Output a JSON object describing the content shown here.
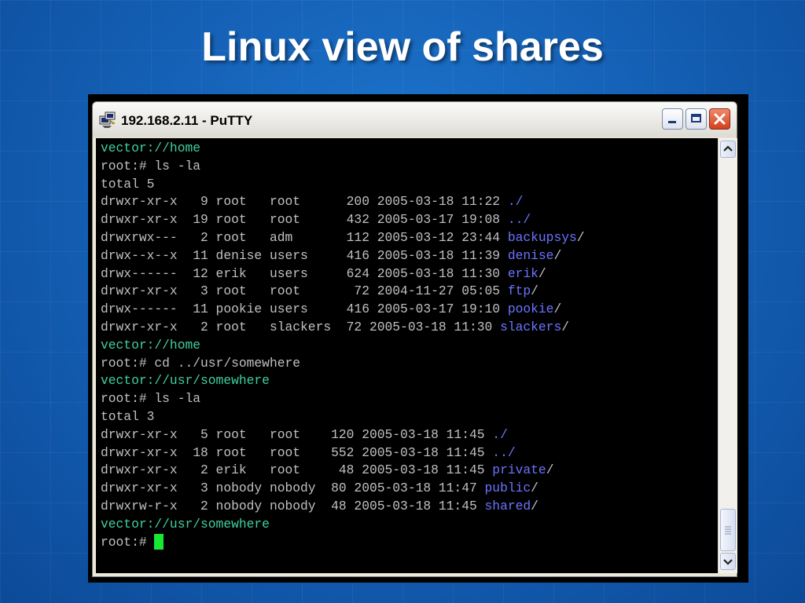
{
  "slide": {
    "title": "Linux view of shares"
  },
  "window": {
    "title": "192.168.2.11 - PuTTY",
    "icon": "putty-icon",
    "controls": [
      "minimize-icon",
      "maximize-icon",
      "close-icon"
    ]
  },
  "terminal": {
    "colors": {
      "prompt": "#3fcf9f",
      "directory": "#6b74ff",
      "text": "#c0c0c0",
      "cursor": "#17e833"
    },
    "lines": [
      {
        "type": "prompt",
        "text": "vector://home"
      },
      {
        "type": "text",
        "text": "root:# ls -la"
      },
      {
        "type": "text",
        "text": "total 5"
      },
      {
        "type": "entry",
        "text": "drwxr-xr-x   9 root   root      200 2005-03-18 11:22 ",
        "name": "./",
        "suffix": ""
      },
      {
        "type": "entry",
        "text": "drwxr-xr-x  19 root   root      432 2005-03-17 19:08 ",
        "name": "../",
        "suffix": ""
      },
      {
        "type": "entry",
        "text": "drwxrwx---   2 root   adm       112 2005-03-12 23:44 ",
        "name": "backupsys",
        "suffix": "/"
      },
      {
        "type": "entry",
        "text": "drwx--x--x  11 denise users     416 2005-03-18 11:39 ",
        "name": "denise",
        "suffix": "/"
      },
      {
        "type": "entry",
        "text": "drwx------  12 erik   users     624 2005-03-18 11:30 ",
        "name": "erik",
        "suffix": "/"
      },
      {
        "type": "entry",
        "text": "drwxr-xr-x   3 root   root       72 2004-11-27 05:05 ",
        "name": "ftp",
        "suffix": "/"
      },
      {
        "type": "entry",
        "text": "drwx------  11 pookie users     416 2005-03-17 19:10 ",
        "name": "pookie",
        "suffix": "/"
      },
      {
        "type": "entry",
        "text": "drwxr-xr-x   2 root   slackers  72 2005-03-18 11:30 ",
        "name": "slackers",
        "suffix": "/"
      },
      {
        "type": "prompt",
        "text": "vector://home"
      },
      {
        "type": "text",
        "text": "root:# cd ../usr/somewhere"
      },
      {
        "type": "prompt",
        "text": "vector://usr/somewhere"
      },
      {
        "type": "text",
        "text": "root:# ls -la"
      },
      {
        "type": "text",
        "text": "total 3"
      },
      {
        "type": "entry",
        "text": "drwxr-xr-x   5 root   root    120 2005-03-18 11:45 ",
        "name": "./",
        "suffix": ""
      },
      {
        "type": "entry",
        "text": "drwxr-xr-x  18 root   root    552 2005-03-18 11:45 ",
        "name": "../",
        "suffix": ""
      },
      {
        "type": "entry",
        "text": "drwxr-xr-x   2 erik   root     48 2005-03-18 11:45 ",
        "name": "private",
        "suffix": "/"
      },
      {
        "type": "entry",
        "text": "drwxr-xr-x   3 nobody nobody  80 2005-03-18 11:47 ",
        "name": "public",
        "suffix": "/"
      },
      {
        "type": "entry",
        "text": "drwxrw-r-x   2 nobody nobody  48 2005-03-18 11:45 ",
        "name": "shared",
        "suffix": "/"
      },
      {
        "type": "prompt",
        "text": "vector://usr/somewhere"
      },
      {
        "type": "cursorline",
        "text": "root:# "
      }
    ]
  },
  "scrollbar": {
    "up_icon": "scroll-up-icon",
    "down_icon": "scroll-down-icon",
    "thumb": "scroll-thumb"
  }
}
